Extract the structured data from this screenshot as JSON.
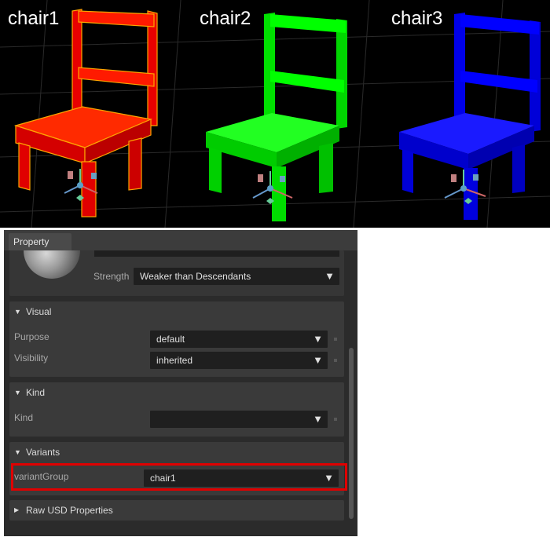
{
  "viewport": {
    "chairs": [
      {
        "label": "chair1",
        "color": "#ff0000"
      },
      {
        "label": "chair2",
        "color": "#00ff00"
      },
      {
        "label": "chair3",
        "color": "#0000ff"
      }
    ],
    "background": "#000000"
  },
  "panel": {
    "tab_label": "Property",
    "strength": {
      "label": "Strength",
      "value": "Weaker than Descendants"
    },
    "visual": {
      "title": "Visual",
      "purpose": {
        "label": "Purpose",
        "value": "default"
      },
      "visibility": {
        "label": "Visibility",
        "value": "inherited"
      }
    },
    "kind": {
      "title": "Kind",
      "kind": {
        "label": "Kind",
        "value": ""
      }
    },
    "variants": {
      "title": "Variants",
      "variant_group": {
        "label": "variantGroup",
        "value": "chair1"
      }
    },
    "raw_usd": {
      "title": "Raw USD Properties"
    },
    "highlight_color": "#e00000"
  }
}
